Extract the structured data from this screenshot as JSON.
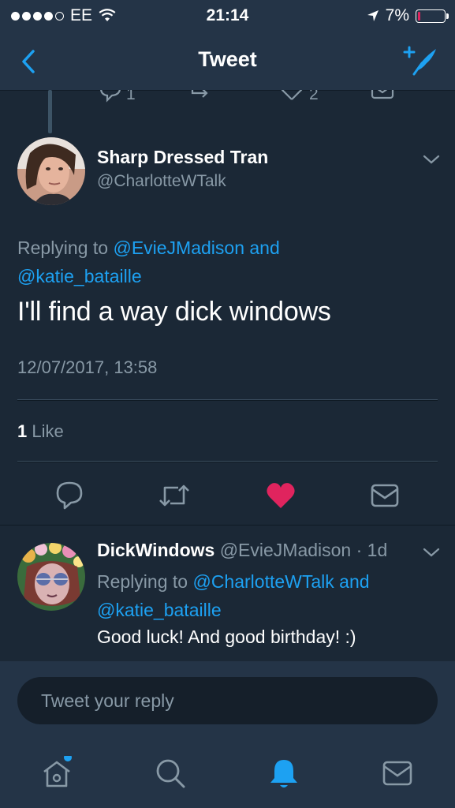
{
  "status_bar": {
    "carrier": "EE",
    "time": "21:14",
    "battery": "7%",
    "battery_level": 0.07,
    "signal_bars": 4
  },
  "nav": {
    "title": "Tweet",
    "back_icon": "chevron-left-icon",
    "compose_icon": "compose-tweet-icon"
  },
  "parent_tweet_actions": {
    "reply_count": "1",
    "like_count": "2"
  },
  "tweet": {
    "display_name": "Sharp Dressed Tran",
    "handle": "@CharlotteWTalk",
    "replying_prefix": "Replying to ",
    "replying_user1": "@EvieJMadison",
    "replying_and": " and",
    "replying_user2": "@katie_bataille",
    "text": "I'll find a way dick windows",
    "timestamp": "12/07/2017, 13:58",
    "like_count": "1",
    "like_label": " Like",
    "liked": true
  },
  "reply": {
    "display_name": "DickWindows",
    "handle": "@EvieJMadison",
    "age": "· 1d",
    "replying_prefix": "Replying to ",
    "replying_user1": "@CharlotteWTalk",
    "replying_and": " and",
    "replying_user2": "@katie_bataille",
    "text": "Good luck! And good birthday! :)"
  },
  "composer": {
    "placeholder": "Tweet your reply"
  },
  "tabs": [
    "home-icon",
    "search-icon",
    "notifications-icon",
    "messages-icon"
  ],
  "colors": {
    "background": "#1b2836",
    "bar": "#243447",
    "accent": "#1da1f2",
    "like": "#e0245e",
    "muted": "#8899a6"
  }
}
